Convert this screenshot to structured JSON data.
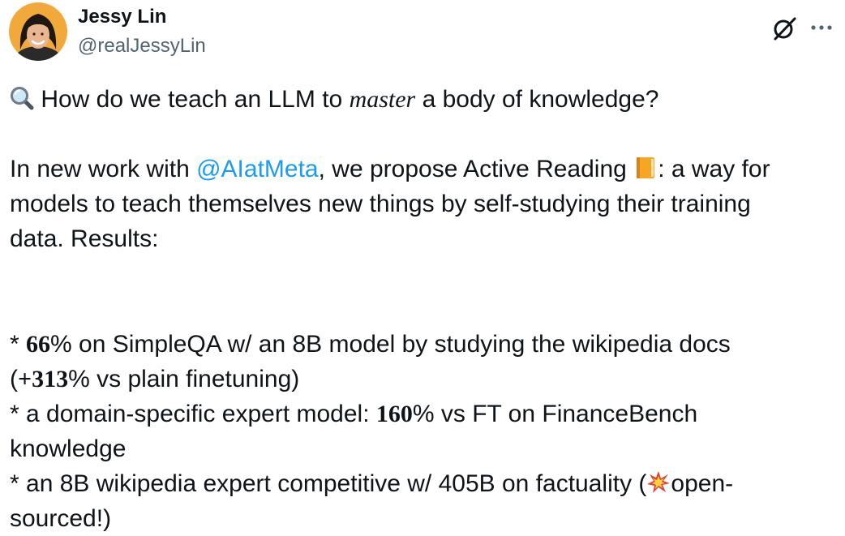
{
  "author": {
    "name": "Jessy Lin",
    "handle": "@realJessyLin"
  },
  "icons": {
    "grok": "grok-icon",
    "more": "more-horizontal-icon",
    "magnifier": "magnifying-glass-emoji",
    "book": "orange-book-emoji",
    "collision": "collision-emoji"
  },
  "colors": {
    "mention": "#1d9bf0",
    "secondary_text": "#536471",
    "text": "#0f1419"
  },
  "tweet": {
    "l1_pre": " How do we teach an LLM to ",
    "l1_italic": "master",
    "l1_post": " a body of knowledge?",
    "p2_pre": "In new work with ",
    "mention": "@AIatMeta",
    "p2_mid": ", we propose Active Reading ",
    "p2_post": ": a way for",
    "p2_line2": "models to teach themselves new things by self-studying their training",
    "p2_line3": "data. Results:",
    "b1_pre": "* ",
    "b1_num": "66",
    "b1_post": "% on SimpleQA w/ an 8B model by studying the wikipedia docs",
    "b1_l2_pre": "(",
    "b1_l2_num": "+313",
    "b1_l2_post": "% vs plain finetuning)",
    "b2_pre": "* a domain-specific expert model: ",
    "b2_num": "160",
    "b2_post": "% vs FT on FinanceBench",
    "b2_l2": "knowledge",
    "b3_pre": "* an 8B wikipedia expert competitive w/ 405B on factuality (",
    "b3_post": "open-",
    "b3_l2": "sourced!)"
  }
}
